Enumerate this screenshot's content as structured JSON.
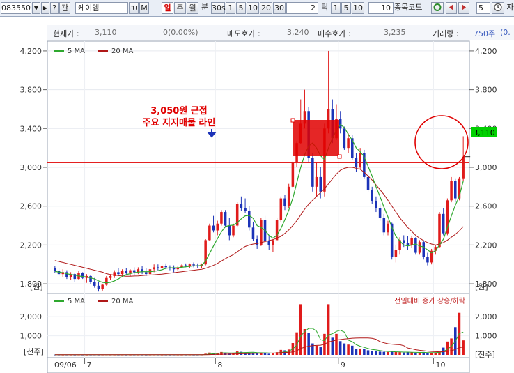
{
  "toolbar": {
    "code_value": "083550",
    "dropdown_glyph": "▼",
    "next_glyph": "▶",
    "help_label": "?",
    "group_label": "관",
    "name_value": "케이엠",
    "t_label": "ㄲ",
    "m_label": "M",
    "period_daily": "일",
    "period_weekly": "주",
    "period_monthly": "월",
    "minute_label": "분",
    "minute_values": [
      "30s",
      "1",
      "5",
      "10",
      "20",
      "30"
    ],
    "tick_count_value": "2",
    "tick_label": "틱",
    "tick_values": [
      "1",
      "5",
      "10"
    ],
    "count_value": "10",
    "code_compare_label": "종목코드",
    "count2_value": "5",
    "right_clip_label": "자"
  },
  "infobar": {
    "price_label": "현재가 :",
    "price_value": "3,110",
    "change_value": "0(0.00%)",
    "ask_label": "매도호가 :",
    "ask_value": "3,240",
    "bid_label": "매수호가 :",
    "bid_value": "3,235",
    "volume_label": "거래량 :",
    "volume_value": "750주",
    "clip_value": "(0."
  },
  "price_panel": {
    "legend_ma5": "5 MA",
    "legend_ma20": "20 MA",
    "y_ticks": [
      "4,200",
      "3,800",
      "3,400",
      "3,000",
      "2,600",
      "2,200",
      "1,800"
    ],
    "unit": "[원]",
    "current_price_badge": "3,110",
    "annotation_line1": "3,050원 근접",
    "annotation_line2": "주요 지지매물 라인",
    "support_level": 3050
  },
  "volume_panel": {
    "legend_ma5": "5 MA",
    "legend_ma20": "20 MA",
    "note": "전일대비 증가 상승/하락",
    "y_ticks": [
      "2,000",
      "1,000"
    ],
    "unit": "[천주]"
  },
  "x_axis": {
    "labels": [
      "09/06",
      "7",
      "8",
      "9",
      "10"
    ]
  },
  "colors": {
    "up": "#e01b1b",
    "down": "#1c33b8",
    "ma5": "#2ea82e",
    "ma20": "#b01818",
    "annotation": "#e00000"
  },
  "chart_data": {
    "type": "candlestick",
    "price": {
      "ylim": [
        1700,
        4300
      ],
      "candles_ohlc": [
        [
          1960,
          1980,
          1910,
          1930
        ],
        [
          1930,
          1960,
          1880,
          1900
        ],
        [
          1900,
          1950,
          1870,
          1920
        ],
        [
          1920,
          1940,
          1850,
          1870
        ],
        [
          1870,
          1920,
          1840,
          1900
        ],
        [
          1900,
          1910,
          1820,
          1850
        ],
        [
          1850,
          1930,
          1840,
          1910
        ],
        [
          1910,
          1920,
          1850,
          1860
        ],
        [
          1860,
          1900,
          1810,
          1880
        ],
        [
          1880,
          1890,
          1800,
          1820
        ],
        [
          1820,
          1860,
          1760,
          1780
        ],
        [
          1780,
          1820,
          1720,
          1750
        ],
        [
          1750,
          1800,
          1730,
          1790
        ],
        [
          1790,
          1880,
          1780,
          1860
        ],
        [
          1860,
          1900,
          1840,
          1880
        ],
        [
          1880,
          1940,
          1860,
          1920
        ],
        [
          1920,
          1960,
          1880,
          1900
        ],
        [
          1900,
          1950,
          1870,
          1930
        ],
        [
          1930,
          1960,
          1890,
          1910
        ],
        [
          1910,
          1950,
          1880,
          1940
        ],
        [
          1940,
          1970,
          1890,
          1920
        ],
        [
          1920,
          1970,
          1900,
          1950
        ],
        [
          1950,
          1980,
          1900,
          1920
        ],
        [
          1920,
          1960,
          1880,
          1900
        ],
        [
          1900,
          1960,
          1890,
          1950
        ],
        [
          1950,
          2000,
          1920,
          1970
        ],
        [
          1970,
          2000,
          1940,
          1960
        ],
        [
          1960,
          2000,
          1930,
          1980
        ],
        [
          1980,
          2010,
          1950,
          1970
        ],
        [
          1970,
          1990,
          1940,
          1960
        ],
        [
          1960,
          1990,
          1920,
          1950
        ],
        [
          1950,
          1980,
          1930,
          1970
        ],
        [
          1970,
          2000,
          1960,
          1990
        ],
        [
          1990,
          2010,
          1970,
          1980
        ],
        [
          1980,
          2010,
          1960,
          2000
        ],
        [
          2000,
          2020,
          1970,
          1990
        ],
        [
          1990,
          2010,
          1960,
          1980
        ],
        [
          1980,
          2010,
          1960,
          2000
        ],
        [
          2000,
          2260,
          1990,
          2250
        ],
        [
          2250,
          2420,
          2240,
          2400
        ],
        [
          2400,
          2500,
          2330,
          2350
        ],
        [
          2350,
          2450,
          2300,
          2420
        ],
        [
          2420,
          2560,
          2400,
          2540
        ],
        [
          2540,
          2560,
          2380,
          2400
        ],
        [
          2400,
          2480,
          2250,
          2300
        ],
        [
          2300,
          2420,
          2280,
          2400
        ],
        [
          2400,
          2640,
          2390,
          2620
        ],
        [
          2620,
          2700,
          2550,
          2580
        ],
        [
          2580,
          2680,
          2530,
          2550
        ],
        [
          2550,
          2600,
          2350,
          2380
        ],
        [
          2380,
          2440,
          2240,
          2260
        ],
        [
          2260,
          2300,
          2160,
          2200
        ],
        [
          2200,
          2480,
          2190,
          2460
        ],
        [
          2460,
          2500,
          2220,
          2240
        ],
        [
          2240,
          2300,
          2150,
          2200
        ],
        [
          2200,
          2260,
          2130,
          2250
        ],
        [
          2250,
          2480,
          2240,
          2460
        ],
        [
          2460,
          2700,
          2440,
          2680
        ],
        [
          2680,
          2720,
          2560,
          2600
        ],
        [
          2600,
          2830,
          2580,
          2800
        ],
        [
          2800,
          3060,
          2790,
          3050
        ],
        [
          3050,
          3270,
          3000,
          3250
        ],
        [
          3250,
          3700,
          3240,
          3450
        ],
        [
          3450,
          3800,
          3400,
          3580
        ],
        [
          3580,
          3620,
          3050,
          3100
        ],
        [
          3100,
          3150,
          2750,
          2800
        ],
        [
          2800,
          3050,
          2700,
          2900
        ],
        [
          2900,
          3000,
          2680,
          2750
        ],
        [
          2750,
          3450,
          2700,
          3400
        ],
        [
          3400,
          4200,
          3350,
          3600
        ],
        [
          3600,
          3700,
          3250,
          3300
        ],
        [
          3300,
          3650,
          3280,
          3500
        ],
        [
          3500,
          3580,
          3350,
          3400
        ],
        [
          3400,
          3420,
          3180,
          3200
        ],
        [
          3200,
          3350,
          3150,
          3300
        ],
        [
          3300,
          3330,
          3080,
          3100
        ],
        [
          3100,
          3150,
          2950,
          3000
        ],
        [
          3000,
          3200,
          2980,
          3150
        ],
        [
          3150,
          3180,
          2880,
          2900
        ],
        [
          2900,
          2950,
          2750,
          2770
        ],
        [
          2770,
          2800,
          2620,
          2650
        ],
        [
          2650,
          2700,
          2540,
          2580
        ],
        [
          2580,
          2620,
          2450,
          2480
        ],
        [
          2480,
          2520,
          2300,
          2330
        ],
        [
          2330,
          2450,
          2300,
          2420
        ],
        [
          2420,
          2430,
          2050,
          2080
        ],
        [
          2080,
          2200,
          2020,
          2150
        ],
        [
          2150,
          2280,
          2100,
          2250
        ],
        [
          2250,
          2300,
          2180,
          2220
        ],
        [
          2220,
          2290,
          2150,
          2200
        ],
        [
          2200,
          2290,
          2170,
          2270
        ],
        [
          2270,
          2280,
          2100,
          2120
        ],
        [
          2120,
          2250,
          2100,
          2230
        ],
        [
          2230,
          2250,
          2050,
          2080
        ],
        [
          2080,
          2120,
          1990,
          2020
        ],
        [
          2020,
          2160,
          2000,
          2140
        ],
        [
          2140,
          2200,
          2100,
          2180
        ],
        [
          2180,
          2540,
          2170,
          2520
        ],
        [
          2520,
          2580,
          2300,
          2320
        ],
        [
          2320,
          2680,
          2300,
          2660
        ],
        [
          2660,
          2900,
          2640,
          2860
        ],
        [
          2860,
          2880,
          2640,
          2680
        ],
        [
          2680,
          2900,
          2660,
          2880
        ],
        [
          2880,
          3320,
          2860,
          3110
        ]
      ],
      "ma5": [
        1930,
        1920,
        1915,
        1905,
        1895,
        1890,
        1880,
        1875,
        1870,
        1860,
        1850,
        1830,
        1815,
        1810,
        1815,
        1830,
        1850,
        1875,
        1895,
        1905,
        1915,
        1920,
        1925,
        1925,
        1925,
        1930,
        1935,
        1945,
        1960,
        1965,
        1965,
        1965,
        1970,
        1975,
        1980,
        1985,
        1985,
        1990,
        2035,
        2110,
        2190,
        2265,
        2335,
        2390,
        2400,
        2405,
        2430,
        2470,
        2500,
        2505,
        2475,
        2400,
        2380,
        2350,
        2300,
        2270,
        2300,
        2370,
        2460,
        2560,
        2680,
        2840,
        3000,
        3130,
        3220,
        3250,
        3200,
        3120,
        3080,
        3200,
        3300,
        3380,
        3440,
        3410,
        3340,
        3280,
        3200,
        3160,
        3110,
        3010,
        2910,
        2800,
        2700,
        2590,
        2490,
        2380,
        2290,
        2240,
        2200,
        2190,
        2200,
        2210,
        2190,
        2180,
        2150,
        2120,
        2140,
        2200,
        2260,
        2380,
        2500,
        2610,
        2700,
        2860
      ],
      "ma20": [
        2040,
        2030,
        2020,
        2010,
        2000,
        1990,
        1980,
        1970,
        1960,
        1950,
        1940,
        1930,
        1920,
        1905,
        1895,
        1890,
        1885,
        1880,
        1878,
        1878,
        1880,
        1882,
        1885,
        1888,
        1890,
        1893,
        1897,
        1900,
        1905,
        1910,
        1915,
        1920,
        1925,
        1930,
        1935,
        1940,
        1945,
        1950,
        1960,
        1975,
        1990,
        2010,
        2035,
        2060,
        2080,
        2100,
        2130,
        2160,
        2185,
        2200,
        2210,
        2215,
        2225,
        2235,
        2245,
        2255,
        2270,
        2290,
        2320,
        2355,
        2400,
        2450,
        2510,
        2570,
        2620,
        2660,
        2700,
        2740,
        2780,
        2830,
        2880,
        2930,
        2970,
        2990,
        3000,
        3000,
        2990,
        2980,
        2950,
        2910,
        2870,
        2820,
        2770,
        2720,
        2660,
        2600,
        2540,
        2480,
        2430,
        2380,
        2340,
        2300,
        2270,
        2245,
        2225,
        2210,
        2200,
        2210,
        2225,
        2250,
        2280,
        2310,
        2345,
        2390
      ]
    },
    "volume": {
      "ylim": [
        0,
        2700
      ],
      "values_thousand_shares": [
        10,
        8,
        6,
        8,
        7,
        6,
        9,
        7,
        6,
        8,
        10,
        7,
        9,
        12,
        8,
        9,
        7,
        8,
        6,
        7,
        9,
        8,
        7,
        6,
        8,
        10,
        9,
        7,
        8,
        6,
        9,
        8,
        7,
        8,
        9,
        7,
        8,
        10,
        60,
        120,
        90,
        110,
        150,
        80,
        70,
        90,
        180,
        160,
        120,
        100,
        110,
        90,
        130,
        110,
        60,
        70,
        140,
        260,
        240,
        280,
        620,
        1180,
        2650,
        1350,
        1150,
        600,
        480,
        400,
        1100,
        2650,
        900,
        1100,
        720,
        600,
        540,
        480,
        320,
        330,
        300,
        240,
        220,
        200,
        170,
        160,
        150,
        170,
        150,
        140,
        120,
        150,
        130,
        110,
        120,
        150,
        100,
        110,
        130,
        160,
        380,
        700,
        860,
        1450,
        2200,
        760
      ]
    }
  }
}
